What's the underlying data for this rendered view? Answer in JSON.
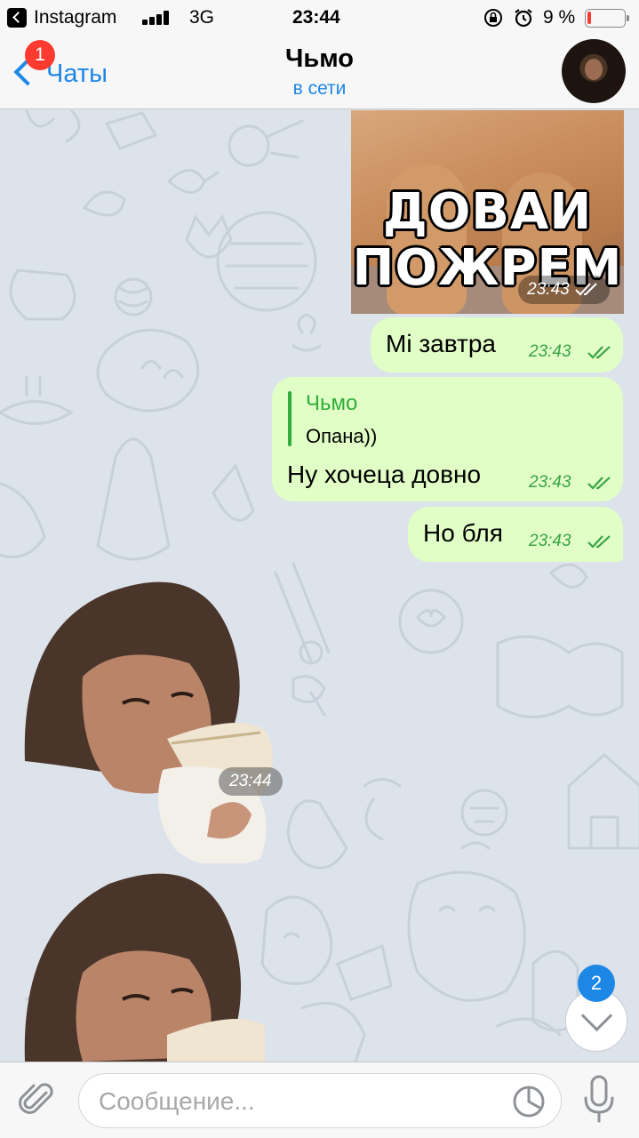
{
  "status_bar": {
    "back_app": "Instagram",
    "network": "3G",
    "time": "23:44",
    "battery_percent": "9 %"
  },
  "header": {
    "back_label": "Чаты",
    "back_badge": "1",
    "title": "Чьмо",
    "subtitle": "в сети",
    "avatar_icon": "contact-avatar"
  },
  "messages": [
    {
      "type": "photo",
      "direction": "outgoing",
      "caption_lines": [
        "ДОВАИ",
        "ПОЖРЕМ"
      ],
      "time": "23:43",
      "status": "read"
    },
    {
      "type": "text",
      "direction": "outgoing",
      "text": "Мі завтра",
      "time": "23:43",
      "status": "read"
    },
    {
      "type": "text",
      "direction": "outgoing",
      "reply_to": {
        "name": "Чьмо",
        "text": "Опана))"
      },
      "text": "Ну хочеца довно",
      "time": "23:43",
      "status": "read"
    },
    {
      "type": "text",
      "direction": "outgoing",
      "text": "Но бля",
      "time": "23:43",
      "status": "read"
    },
    {
      "type": "sticker",
      "direction": "incoming",
      "time": "23:44"
    },
    {
      "type": "sticker",
      "direction": "incoming"
    }
  ],
  "scroll_down": {
    "badge": "2"
  },
  "input": {
    "placeholder": "Сообщение...",
    "attach_icon": "paperclip-icon",
    "sticker_icon": "sticker-icon",
    "mic_icon": "microphone-icon"
  },
  "colors": {
    "accent": "#1d87e6",
    "outgoing_bubble": "#e1fec6",
    "outgoing_time": "#3aa346",
    "reply_accent": "#2fae3c",
    "chat_background": "#dde3ea",
    "badge_red": "#ff3b30"
  }
}
